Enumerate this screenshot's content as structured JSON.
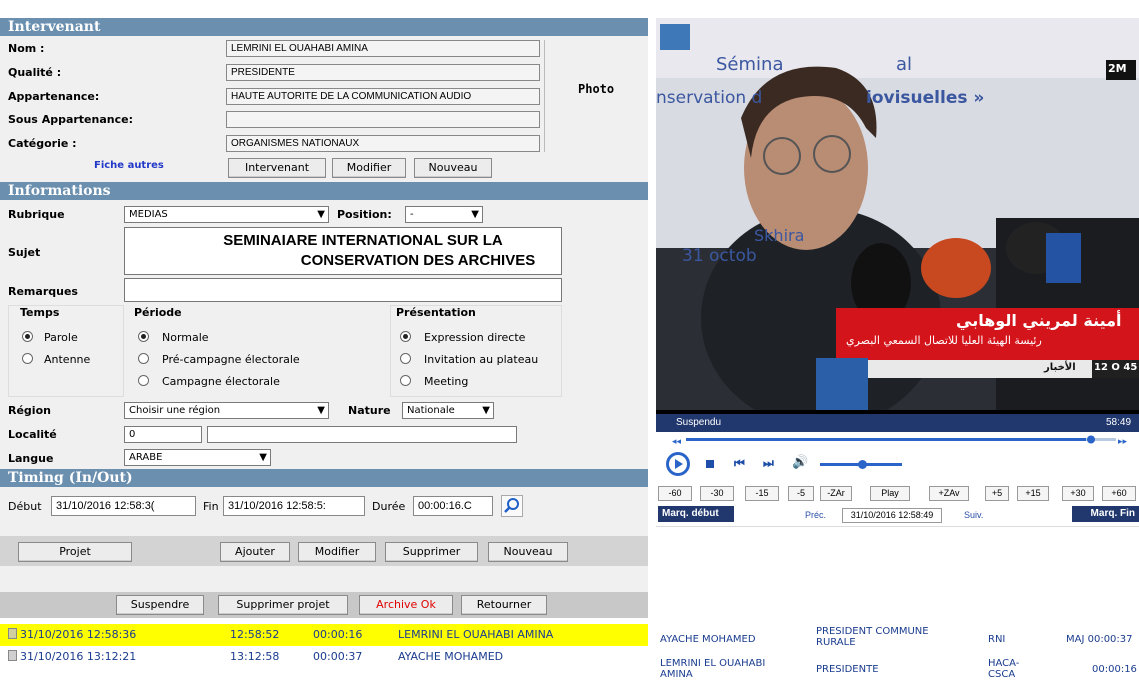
{
  "intervenant": {
    "title": "Intervenant",
    "nom_label": "Nom :",
    "nom": "LEMRINI EL OUAHABI AMINA",
    "qualite_label": "Qualité :",
    "qualite": "PRESIDENTE",
    "appartenance_label": "Appartenance:",
    "appartenance": "HAUTE AUTORITE DE LA COMMUNICATION AUDIO",
    "sous_label": "Sous Appartenance:",
    "sous": "",
    "categorie_label": "Catégorie :",
    "categorie": "ORGANISMES NATIONAUX",
    "photo_label": "Photo",
    "fiche_autres": "Fiche autres",
    "btn_intervenant": "Intervenant",
    "btn_modifier": "Modifier",
    "btn_nouveau": "Nouveau"
  },
  "informations": {
    "title": "Informations",
    "rubrique_label": "Rubrique",
    "rubrique": "MEDIAS",
    "position_label": "Position:",
    "position": "-",
    "sujet_label": "Sujet",
    "sujet_line1": "SEMINAIARE INTERNATIONAL SUR LA",
    "sujet_line2": "CONSERVATION DES ARCHIVES",
    "remarques_label": "Remarques",
    "temps_label": "Temps",
    "temps_opt1": "Parole",
    "temps_opt2": "Antenne",
    "periode_label": "Période",
    "periode_opt1": "Normale",
    "periode_opt2": "Pré-campagne électorale",
    "periode_opt3": "Campagne électorale",
    "presentation_label": "Présentation",
    "pres_opt1": "Expression directe",
    "pres_opt2": "Invitation au plateau",
    "pres_opt3": "Meeting",
    "region_label": "Région",
    "region": "Choisir une région",
    "nature_label": "Nature",
    "nature": "Nationale",
    "localite_label": "Localité",
    "localite": "0",
    "langue_label": "Langue",
    "langue": "ARABE"
  },
  "timing": {
    "title": "Timing (In/Out)",
    "debut_label": "Début",
    "debut": "31/10/2016 12:58:3(",
    "fin_label": "Fin",
    "fin": "31/10/2016 12:58:5:",
    "duree_label": "Durée",
    "duree": "00:00:16.C"
  },
  "actions": {
    "projet": "Projet",
    "ajouter": "Ajouter",
    "modifier": "Modifier",
    "supprimer": "Supprimer",
    "nouveau": "Nouveau",
    "suspendre": "Suspendre",
    "supprimer_projet": "Supprimer projet",
    "archive_ok": "Archive Ok",
    "retourner": "Retourner"
  },
  "list": [
    {
      "date": "31/10/2016 12:58:36",
      "out": "12:58:52",
      "dur": "00:00:16",
      "name": "LEMRINI EL OUAHABI AMINA"
    },
    {
      "date": "31/10/2016 13:12:21",
      "out": "13:12:58",
      "dur": "00:00:37",
      "name": "AYACHE MOHAMED"
    }
  ],
  "video": {
    "seminar_text1": "Sémina",
    "seminar_text2": "al",
    "seminar_text3": "nservation d",
    "seminar_text4": "iovisuelles »",
    "skhir": "Skhira",
    "date_text": "31 octob",
    "channel": "2M",
    "caption_ar1": "أمينة لمريني الوهابي",
    "caption_ar2": "رئيسة الهيئة العليا للاتصال السمعي البصري",
    "news_ar": "الأخبار",
    "clock": "12 O 45",
    "status": "Suspendu",
    "time": "58:49"
  },
  "player": {
    "buttons": [
      "-60",
      "-30",
      "-15",
      "-5",
      "-ZAr",
      "Play",
      "+ZAv",
      "+5",
      "+15",
      "+30",
      "+60"
    ],
    "marq_debut": "Marq. début",
    "prec": "Préc.",
    "current": "31/10/2016 12:58:49",
    "suiv": "Suiv.",
    "marq_fin": "Marq. Fin"
  },
  "right_list": [
    {
      "name": "AYACHE MOHAMED",
      "role": "PRESIDENT COMMUNE RURALE",
      "org": "RNI",
      "time": "MAJ 00:00:37"
    },
    {
      "name": "LEMRINI EL OUAHABI AMINA",
      "role": "PRESIDENTE",
      "org": "HACA-CSCA",
      "time": "00:00:16"
    }
  ]
}
